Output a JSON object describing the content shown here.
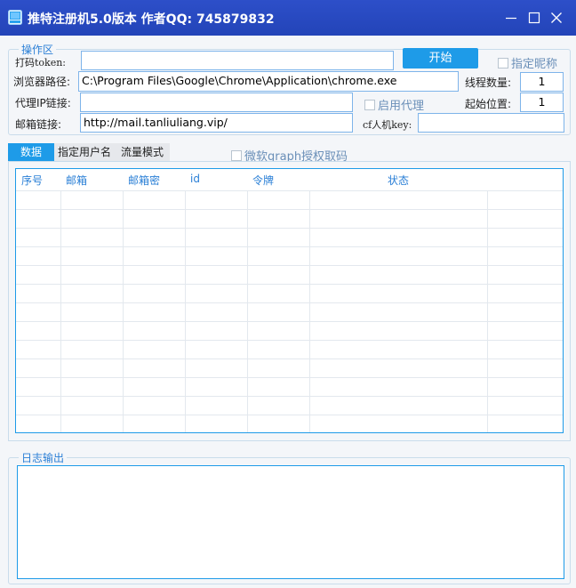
{
  "window": {
    "title": "推特注册机5.0版本 作者QQ: 745879832",
    "controls": [
      "minimize-icon",
      "maximize-icon",
      "close-icon"
    ]
  },
  "operation_area": {
    "legend": "操作区",
    "captcha_token_label": "打码token:",
    "captcha_token_value": "",
    "start_button": "开始",
    "nickname_checkbox_label": "指定昵称",
    "browser_path_label": "浏览器路径:",
    "browser_path_value": "C:\\Program Files\\Google\\Chrome\\Application\\chrome.exe",
    "thread_count_label": "线程数量:",
    "thread_count_value": "1",
    "proxy_label": "代理IP链接:",
    "proxy_value": "",
    "enable_proxy_label": "启用代理",
    "start_pos_label": "起始位置:",
    "start_pos_value": "1",
    "email_link_label": "邮箱链接:",
    "email_link_value": "http://mail.tanliuliang.vip/",
    "cf_key_label": "cf人机key:",
    "cf_key_value": ""
  },
  "tabs": [
    {
      "label": "数据",
      "active": true
    },
    {
      "label": "指定用户名",
      "active": false
    },
    {
      "label": "流量模式",
      "active": false
    }
  ],
  "graph_checkbox_label": "微软graph授权取码",
  "table": {
    "columns": [
      "序号",
      "邮箱",
      "邮箱密",
      "id",
      "令牌",
      "状态"
    ],
    "rows": []
  },
  "log": {
    "legend": "日志输出",
    "content": ""
  },
  "colors": {
    "titlebar": "#2344b8",
    "accent": "#1e9be8",
    "legend_text": "#2a7fd6",
    "checkbox_text": "#6a8fb8"
  }
}
